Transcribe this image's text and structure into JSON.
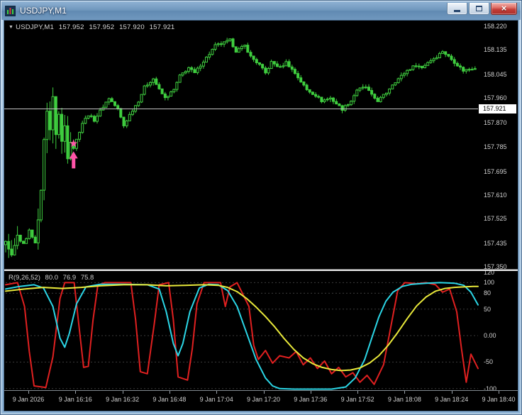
{
  "window": {
    "title": "USDJPY,M1"
  },
  "icons": {
    "app": "chart-icon",
    "minimize": "minimize-icon",
    "maximize": "maximize-icon",
    "close": "close-icon",
    "close_glyph": "×",
    "dropdown_glyph": "▼"
  },
  "colors": {
    "background": "#000000",
    "candle": "#3fce3f",
    "bid_line": "#c4c4c4",
    "axis_text": "#d2d2d2",
    "level_line": "#3c3c3c",
    "signal": "#ff54a8"
  },
  "chart_data": {
    "type": "candlestick",
    "main": {
      "header": {
        "symbol": "USDJPY,M1",
        "open": "157.952",
        "high": "157.952",
        "low": "157.920",
        "close": "157.921"
      },
      "price_axis_labels": [
        "158.220",
        "158.135",
        "158.045",
        "157.960",
        "157.870",
        "157.785",
        "157.695",
        "157.610",
        "157.525",
        "157.435",
        "157.350"
      ],
      "current_price_label": "157.921",
      "bid_price": 157.921,
      "candle_count": 160,
      "close_anchors": [
        [
          0,
          157.43
        ],
        [
          2,
          157.38
        ],
        [
          3,
          157.42
        ],
        [
          4,
          157.46
        ],
        [
          6,
          157.43
        ],
        [
          8,
          157.48
        ],
        [
          10,
          157.44
        ],
        [
          11,
          157.5
        ],
        [
          12,
          157.64
        ],
        [
          13,
          157.8
        ],
        [
          14,
          157.93
        ],
        [
          15,
          157.85
        ],
        [
          16,
          157.95
        ],
        [
          17,
          157.84
        ],
        [
          18,
          157.9
        ],
        [
          19,
          157.8
        ],
        [
          20,
          157.86
        ],
        [
          21,
          157.76
        ],
        [
          22,
          157.82
        ],
        [
          23,
          157.78
        ],
        [
          24,
          157.81
        ],
        [
          26,
          157.87
        ],
        [
          28,
          157.9
        ],
        [
          30,
          157.88
        ],
        [
          33,
          157.93
        ],
        [
          35,
          157.96
        ],
        [
          38,
          157.92
        ],
        [
          40,
          157.86
        ],
        [
          42,
          157.9
        ],
        [
          45,
          157.95
        ],
        [
          47,
          158.0
        ],
        [
          50,
          158.03
        ],
        [
          52,
          157.99
        ],
        [
          54,
          157.96
        ],
        [
          57,
          157.99
        ],
        [
          59,
          158.04
        ],
        [
          62,
          158.07
        ],
        [
          64,
          158.05
        ],
        [
          66,
          158.08
        ],
        [
          69,
          158.12
        ],
        [
          71,
          158.15
        ],
        [
          74,
          158.16
        ],
        [
          76,
          158.17
        ],
        [
          78,
          158.13
        ],
        [
          81,
          158.15
        ],
        [
          83,
          158.11
        ],
        [
          86,
          158.08
        ],
        [
          88,
          158.05
        ],
        [
          90,
          158.09
        ],
        [
          93,
          158.07
        ],
        [
          95,
          158.09
        ],
        [
          98,
          158.05
        ],
        [
          100,
          158.02
        ],
        [
          102,
          157.99
        ],
        [
          105,
          157.97
        ],
        [
          107,
          157.95
        ],
        [
          110,
          157.96
        ],
        [
          112,
          157.94
        ],
        [
          114,
          157.92
        ],
        [
          117,
          157.95
        ],
        [
          119,
          157.99
        ],
        [
          122,
          158.0
        ],
        [
          124,
          157.97
        ],
        [
          126,
          157.95
        ],
        [
          129,
          157.98
        ],
        [
          131,
          158.01
        ],
        [
          134,
          158.04
        ],
        [
          136,
          158.06
        ],
        [
          139,
          158.08
        ],
        [
          141,
          158.07
        ],
        [
          143,
          158.09
        ],
        [
          146,
          158.11
        ],
        [
          148,
          158.13
        ],
        [
          151,
          158.1
        ],
        [
          153,
          158.08
        ],
        [
          155,
          158.06
        ],
        [
          159,
          158.07
        ]
      ],
      "wick_zones": [
        [
          0,
          4,
          0.035
        ],
        [
          11,
          22,
          0.055
        ]
      ],
      "signal": {
        "shapes": [
          "star",
          "up-arrow"
        ],
        "candle_index": 23,
        "price": 157.775,
        "color": "#ff54a8"
      }
    },
    "indicator": {
      "name": "R(9,26,52)",
      "values": [
        "80.0",
        "76.9",
        "75.8"
      ],
      "axis_labels": [
        "120",
        "100",
        "80",
        "50",
        "0.00",
        "-50",
        "-100"
      ],
      "range": [
        -103,
        122
      ],
      "levels": [
        100,
        80,
        50,
        0,
        -50,
        -100
      ],
      "series": [
        {
          "name": "fast",
          "color": "#e02020",
          "points": [
            [
              0,
              96
            ],
            [
              0.025,
              100
            ],
            [
              0.04,
              55
            ],
            [
              0.05,
              -30
            ],
            [
              0.06,
              -95
            ],
            [
              0.085,
              -98
            ],
            [
              0.1,
              -40
            ],
            [
              0.115,
              70
            ],
            [
              0.125,
              100
            ],
            [
              0.145,
              100
            ],
            [
              0.155,
              20
            ],
            [
              0.165,
              -60
            ],
            [
              0.175,
              -58
            ],
            [
              0.185,
              30
            ],
            [
              0.195,
              95
            ],
            [
              0.21,
              100
            ],
            [
              0.265,
              100
            ],
            [
              0.275,
              30
            ],
            [
              0.285,
              -68
            ],
            [
              0.3,
              -72
            ],
            [
              0.315,
              25
            ],
            [
              0.325,
              96
            ],
            [
              0.345,
              100
            ],
            [
              0.355,
              30
            ],
            [
              0.365,
              -78
            ],
            [
              0.385,
              -84
            ],
            [
              0.395,
              -25
            ],
            [
              0.405,
              60
            ],
            [
              0.42,
              100
            ],
            [
              0.455,
              100
            ],
            [
              0.465,
              55
            ],
            [
              0.475,
              92
            ],
            [
              0.49,
              100
            ],
            [
              0.515,
              55
            ],
            [
              0.525,
              -18
            ],
            [
              0.535,
              -45
            ],
            [
              0.55,
              -28
            ],
            [
              0.565,
              -52
            ],
            [
              0.58,
              -38
            ],
            [
              0.6,
              -42
            ],
            [
              0.615,
              -30
            ],
            [
              0.63,
              -55
            ],
            [
              0.645,
              -42
            ],
            [
              0.66,
              -62
            ],
            [
              0.675,
              -48
            ],
            [
              0.69,
              -72
            ],
            [
              0.705,
              -60
            ],
            [
              0.72,
              -78
            ],
            [
              0.735,
              -70
            ],
            [
              0.75,
              -88
            ],
            [
              0.765,
              -75
            ],
            [
              0.78,
              -92
            ],
            [
              0.8,
              -55
            ],
            [
              0.815,
              15
            ],
            [
              0.83,
              85
            ],
            [
              0.845,
              100
            ],
            [
              0.87,
              98
            ],
            [
              0.89,
              100
            ],
            [
              0.91,
              96
            ],
            [
              0.925,
              82
            ],
            [
              0.94,
              88
            ],
            [
              0.955,
              45
            ],
            [
              0.965,
              -25
            ],
            [
              0.975,
              -88
            ],
            [
              0.985,
              -35
            ],
            [
              1,
              -62
            ]
          ]
        },
        {
          "name": "medium",
          "color": "#2bd6e6",
          "points": [
            [
              0,
              88
            ],
            [
              0.03,
              93
            ],
            [
              0.06,
              96
            ],
            [
              0.08,
              90
            ],
            [
              0.1,
              55
            ],
            [
              0.115,
              -5
            ],
            [
              0.125,
              -22
            ],
            [
              0.135,
              5
            ],
            [
              0.15,
              60
            ],
            [
              0.17,
              92
            ],
            [
              0.2,
              97
            ],
            [
              0.25,
              97
            ],
            [
              0.3,
              96
            ],
            [
              0.325,
              88
            ],
            [
              0.34,
              45
            ],
            [
              0.355,
              -15
            ],
            [
              0.365,
              -38
            ],
            [
              0.375,
              -15
            ],
            [
              0.39,
              45
            ],
            [
              0.41,
              90
            ],
            [
              0.43,
              97
            ],
            [
              0.45,
              96
            ],
            [
              0.47,
              85
            ],
            [
              0.49,
              55
            ],
            [
              0.51,
              5
            ],
            [
              0.53,
              -45
            ],
            [
              0.55,
              -80
            ],
            [
              0.565,
              -95
            ],
            [
              0.58,
              -100
            ],
            [
              0.61,
              -101
            ],
            [
              0.65,
              -101
            ],
            [
              0.69,
              -101
            ],
            [
              0.72,
              -97
            ],
            [
              0.74,
              -80
            ],
            [
              0.76,
              -45
            ],
            [
              0.775,
              -5
            ],
            [
              0.79,
              35
            ],
            [
              0.805,
              65
            ],
            [
              0.82,
              82
            ],
            [
              0.84,
              93
            ],
            [
              0.86,
              97
            ],
            [
              0.89,
              99
            ],
            [
              0.92,
              100
            ],
            [
              0.95,
              99
            ],
            [
              0.97,
              95
            ],
            [
              0.985,
              82
            ],
            [
              1,
              58
            ]
          ]
        },
        {
          "name": "slow",
          "color": "#e9e93a",
          "points": [
            [
              0,
              84
            ],
            [
              0.04,
              88
            ],
            [
              0.08,
              91
            ],
            [
              0.12,
              89
            ],
            [
              0.16,
              91
            ],
            [
              0.2,
              94
            ],
            [
              0.25,
              96
            ],
            [
              0.3,
              96
            ],
            [
              0.34,
              94
            ],
            [
              0.38,
              95
            ],
            [
              0.42,
              96
            ],
            [
              0.45,
              95
            ],
            [
              0.47,
              91
            ],
            [
              0.49,
              83
            ],
            [
              0.51,
              70
            ],
            [
              0.53,
              54
            ],
            [
              0.55,
              36
            ],
            [
              0.57,
              16
            ],
            [
              0.59,
              -6
            ],
            [
              0.61,
              -26
            ],
            [
              0.63,
              -42
            ],
            [
              0.65,
              -53
            ],
            [
              0.67,
              -60
            ],
            [
              0.69,
              -64
            ],
            [
              0.71,
              -66
            ],
            [
              0.73,
              -65
            ],
            [
              0.75,
              -61
            ],
            [
              0.77,
              -52
            ],
            [
              0.79,
              -38
            ],
            [
              0.81,
              -18
            ],
            [
              0.83,
              6
            ],
            [
              0.85,
              32
            ],
            [
              0.87,
              56
            ],
            [
              0.89,
              73
            ],
            [
              0.91,
              84
            ],
            [
              0.93,
              89
            ],
            [
              0.95,
              91
            ],
            [
              0.97,
              92
            ],
            [
              0.99,
              93
            ],
            [
              1,
              93
            ]
          ]
        }
      ]
    },
    "time_axis_labels": [
      "9 Jan 2026",
      "9 Jan 16:16",
      "9 Jan 16:32",
      "9 Jan 16:48",
      "9 Jan 17:04",
      "9 Jan 17:20",
      "9 Jan 17:36",
      "9 Jan 17:52",
      "9 Jan 18:08",
      "9 Jan 18:24",
      "9 Jan 18:40"
    ]
  }
}
